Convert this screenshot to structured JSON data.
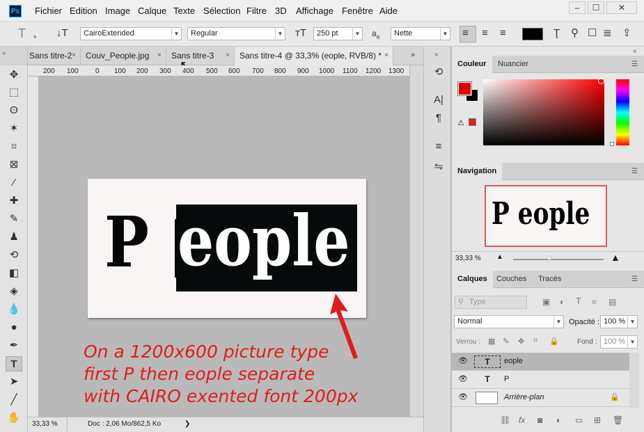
{
  "menubar": {
    "logo": "Ps",
    "items": [
      "Fichier",
      "Edition",
      "Image",
      "Calque",
      "Texte",
      "Sélection",
      "Filtre",
      "3D",
      "Affichage",
      "Fenêtre",
      "Aide"
    ]
  },
  "options": {
    "font_family": "CairoExtended",
    "font_style": "Regular",
    "font_size": "250 pt",
    "aa_label": "a",
    "antialias": "Nette"
  },
  "tabs": [
    {
      "label": "Sans titre-2",
      "x": "×"
    },
    {
      "label": "Couv_People.jpg",
      "x": "×"
    },
    {
      "label": "Sans titre-3",
      "x": "×"
    },
    {
      "label": "Sans titre-4 @ 33,3% (eople, RVB/8) *",
      "x": "×"
    }
  ],
  "ruler_labels": [
    "200",
    "100",
    "0",
    "100",
    "200",
    "300",
    "400",
    "500",
    "600",
    "700",
    "800",
    "900",
    "1000",
    "1100",
    "1200",
    "1300"
  ],
  "canvas": {
    "letter_p": "P",
    "word_eople": "eople"
  },
  "annotation": {
    "line1": "On a 1200x600 picture type",
    "line2": "first P then eople separate",
    "line3": "with CAIRO exented font 200px"
  },
  "status": {
    "zoom": "33,33 %",
    "doc": "Doc : 2,06 Mo/862,5 Ko",
    "arrow": "❯"
  },
  "panels": {
    "color_tab": "Couleur",
    "swatches_tab": "Nuancier",
    "nav_tab": "Navigation",
    "nav_preview": "P eople",
    "nav_zoom": "33,33 %",
    "layers_tab": "Calques",
    "channels_tab": "Couches",
    "paths_tab": "Tracés",
    "filter_placeholder": "Type",
    "blend_mode": "Normal",
    "opacity_label": "Opacité :",
    "opacity_value": "100 %",
    "lock_label": "Verrou :",
    "fill_label": "Fond :",
    "fill_value": "100 %"
  },
  "layers": [
    {
      "thumb": "T",
      "name": "eople"
    },
    {
      "thumb": "T",
      "name": "P"
    },
    {
      "thumb": "",
      "name": "Arrière-plan"
    }
  ],
  "colors": {
    "accent": "#e11c1c",
    "foreground": "#e10000",
    "background": "#000000"
  }
}
